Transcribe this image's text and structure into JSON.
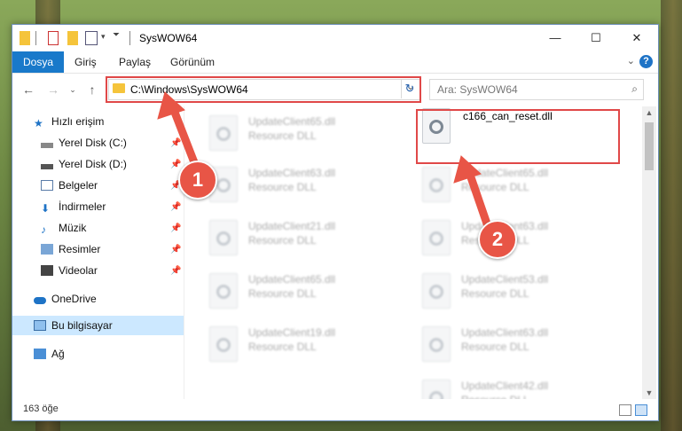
{
  "window": {
    "title": "SysWOW64"
  },
  "ribbon": {
    "tabs": [
      "Dosya",
      "Giriş",
      "Paylaş",
      "Görünüm"
    ]
  },
  "nav": {
    "address": "C:\\Windows\\SysWOW64",
    "search_placeholder": "Ara: SysWOW64"
  },
  "sidebar": {
    "quick_access": "Hızlı erişim",
    "items": [
      "Yerel Disk (C:)",
      "Yerel Disk (D:)",
      "Belgeler",
      "İndirmeler",
      "Müzik",
      "Resimler",
      "Videolar"
    ],
    "onedrive": "OneDrive",
    "this_pc": "Bu bilgisayar",
    "network": "Ağ"
  },
  "files": {
    "left": [
      {
        "name": "UpdateClient65.dll",
        "type": "Resource DLL"
      },
      {
        "name": "UpdateClient63.dll",
        "type": "Resource DLL"
      },
      {
        "name": "UpdateClient21.dll",
        "type": "Resource DLL"
      },
      {
        "name": "UpdateClient65.dll",
        "type": "Resource DLL"
      },
      {
        "name": "UpdateClient19.dll",
        "type": "Resource DLL"
      }
    ],
    "highlighted": {
      "name": "c166_can_reset.dll"
    },
    "right": [
      {
        "name": "UpdateClient65.dll",
        "type": "Resource DLL"
      },
      {
        "name": "UpdateClient63.dll",
        "type": "Resource DLL"
      },
      {
        "name": "UpdateClient53.dll",
        "type": "Resource DLL"
      },
      {
        "name": "UpdateClient63.dll",
        "type": "Resource DLL"
      },
      {
        "name": "UpdateClient42.dll",
        "type": "Resource DLL"
      }
    ]
  },
  "status": {
    "count": "163 öğe"
  },
  "annotations": {
    "step1": "1",
    "step2": "2"
  },
  "colors": {
    "accent": "#1979ca",
    "annotation_red": "#e04848"
  }
}
